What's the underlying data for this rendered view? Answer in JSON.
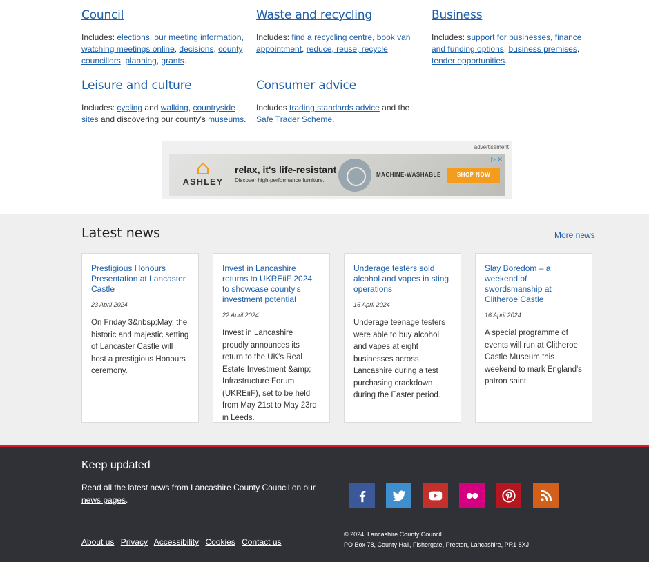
{
  "services": [
    {
      "title": "Council",
      "prefix": "Includes:",
      "links": [
        "elections",
        "our meeting information",
        "watching meetings online",
        "decisions",
        "county councillors",
        "planning",
        "grants"
      ]
    },
    {
      "title": "Waste and recycling",
      "prefix": "Includes:",
      "links": [
        "find a recycling centre",
        "book van appointment",
        "reduce, reuse, recycle"
      ]
    },
    {
      "title": "Business",
      "prefix": "Includes:",
      "links": [
        "support for businesses",
        "finance and funding options",
        "business premises",
        "tender opportunities"
      ]
    },
    {
      "title": "Leisure and culture",
      "prefix": "Includes:",
      "links": [
        "cycling",
        "walking",
        "countryside sites",
        "museums"
      ],
      "connector_and": "and",
      "tail_text": "and discovering our county's"
    },
    {
      "title": "Consumer advice",
      "prefix": "Includes",
      "links": [
        "trading standards advice",
        "Safe Trader Scheme"
      ],
      "connector": "and the"
    }
  ],
  "ad": {
    "label": "advertisement",
    "brand": "ASHLEY",
    "headline": "relax, it's life-resistant",
    "subline": "Discover high-performance furniture.",
    "feature": "MACHINE-WASHABLE",
    "cta": "SHOP NOW",
    "adchoices": "▷ ✕"
  },
  "news": {
    "heading": "Latest news",
    "more": "More news",
    "items": [
      {
        "title": "Prestigious Honours Presentation at Lancaster Castle",
        "date": "23 April 2024",
        "summary": "On Friday 3&nbsp;May, the historic and majestic setting of Lancaster Castle will host a prestigious Honours ceremony."
      },
      {
        "title": "Invest in Lancashire returns to UKREiiF 2024 to showcase county's investment potential",
        "date": "22 April 2024",
        "summary": "Invest in Lancashire proudly announces its return to the UK's Real Estate Investment &amp; Infrastructure Forum (UKREiiF), set to be held from May 21st to May 23rd in Leeds."
      },
      {
        "title": "Underage testers sold alcohol and vapes in sting operations",
        "date": "16 April 2024",
        "summary": "Underage teenage testers were able to buy alcohol and vapes at eight businesses across Lancashire during a test purchasing crackdown during the Easter period."
      },
      {
        "title": "Slay Boredom – a weekend of swordsmanship at Clitheroe Castle",
        "date": "16 April 2024",
        "summary": "A special programme of events will run at Clitheroe Castle Museum this weekend to mark England's patron saint."
      }
    ]
  },
  "footer": {
    "heading": "Keep updated",
    "text": "Read all the latest news from Lancashire County Council on our",
    "link": "news pages",
    "text_end": ".",
    "social": [
      {
        "icon": "facebook-icon",
        "color": "#3b5998"
      },
      {
        "icon": "twitter-icon",
        "color": "#3f8fce"
      },
      {
        "icon": "youtube-icon",
        "color": "#c4302b"
      },
      {
        "icon": "flickr-icon",
        "color": "#d5007f"
      },
      {
        "icon": "pinterest-icon",
        "color": "#b6161f"
      },
      {
        "icon": "rss-icon",
        "color": "#d2601a"
      }
    ],
    "links": [
      "About us",
      "Privacy",
      "Accessibility",
      "Cookies",
      "Contact us"
    ],
    "copyright": "© 2024, Lancashire County Council",
    "address": "PO Box 78, County Hall, Fishergate, Preston, Lancashire, PR1 8XJ"
  }
}
